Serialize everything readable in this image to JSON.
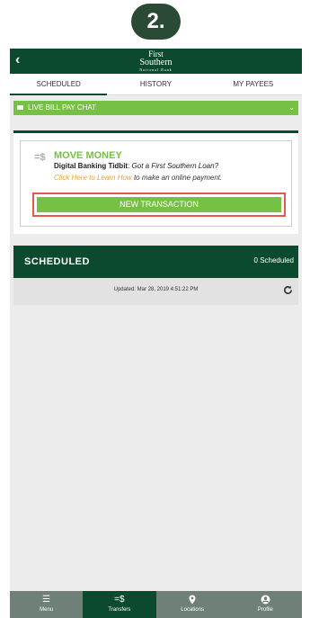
{
  "step_badge": "2.",
  "header": {
    "back_icon": "chevron-left-icon",
    "logo_line1": "First",
    "logo_line2": "Southern",
    "logo_line3": "National Bank"
  },
  "tabs": [
    {
      "label": "SCHEDULED",
      "active": true
    },
    {
      "label": "HISTORY",
      "active": false
    },
    {
      "label": "MY PAYEES",
      "active": false
    }
  ],
  "chat": {
    "label": "LIVE BILL PAY CHAT",
    "icon": "chat-icon",
    "chevron": "chevron-down-icon"
  },
  "move_money": {
    "icon": "money-transfer-icon",
    "title": "MOVE MONEY",
    "tidbit_label": "Digital Banking Tidbit",
    "tidbit_text": "Got a First Southern Loan?",
    "link_text": "Click Here to Learn How",
    "link_suffix": "to make an online payment.",
    "button_label": "NEW TRANSACTION"
  },
  "scheduled": {
    "title": "SCHEDULED",
    "count": "0 Scheduled",
    "updated": "Updated: Mar 28, 2019 4:51:22 PM"
  },
  "bottom_nav": [
    {
      "label": "Menu",
      "icon": "menu-icon",
      "active": false
    },
    {
      "label": "Transfers",
      "icon": "transfer-icon",
      "active": true
    },
    {
      "label": "Locations",
      "icon": "location-pin-icon",
      "active": false
    },
    {
      "label": "Profile",
      "icon": "profile-icon",
      "active": false
    }
  ],
  "colors": {
    "brand_dark_green": "#0c4a30",
    "accent_green": "#76c043",
    "highlight_red": "#e8584a",
    "link_orange": "#e8a23b"
  }
}
